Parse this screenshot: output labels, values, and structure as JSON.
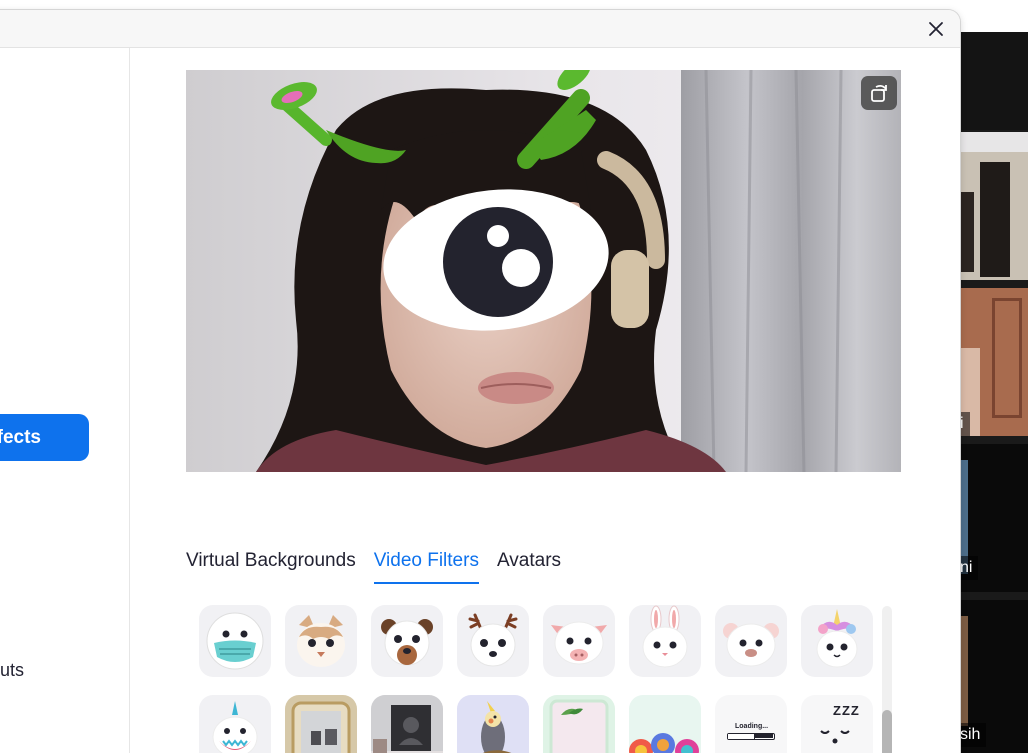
{
  "dialog": {
    "close_icon": "close-icon"
  },
  "sidebar": {
    "active_item": "ffects",
    "partial_item": "uts"
  },
  "preview": {
    "rotate_icon": "rotate-camera-icon"
  },
  "tabs": [
    {
      "label": "Virtual Backgrounds",
      "active": false
    },
    {
      "label": "Video Filters",
      "active": true
    },
    {
      "label": "Avatars",
      "active": false
    }
  ],
  "filters_row1": [
    "medical-mask-filter",
    "cat-face-filter",
    "bear-face-filter",
    "deer-face-filter",
    "pig-face-filter",
    "bunny-face-filter",
    "sheep-face-filter",
    "unicorn-face-filter"
  ],
  "filters_row2": [
    "shark-unicorn-filter",
    "mirror-frame-filter",
    "portrait-frame-filter",
    "cockatiel-filter",
    "green-frame-filter",
    "lollipop-filter",
    "loading-bar-filter",
    "sleepy-face-filter"
  ],
  "loading_label": "Loading...",
  "sleepy_label": "ZZZ",
  "gallery": {
    "tiles": [
      {
        "name": ""
      },
      {
        "name": "i"
      },
      {
        "name": "ni"
      },
      {
        "name": "sih"
      }
    ]
  },
  "colors": {
    "accent": "#0e72ed",
    "text": "#232333"
  }
}
